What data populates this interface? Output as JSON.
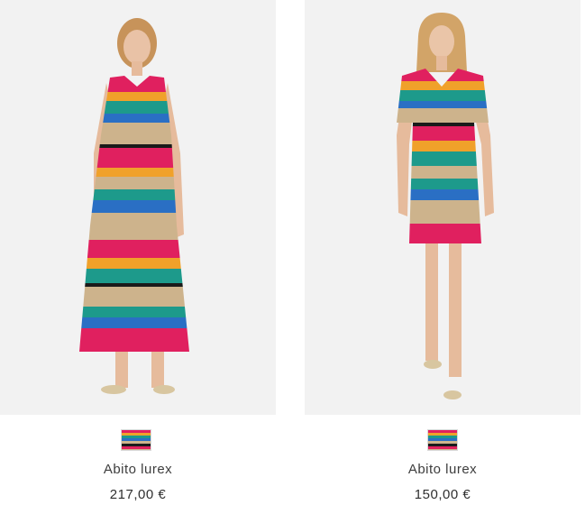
{
  "products": [
    {
      "name": "Abito lurex",
      "price": "217,00 €",
      "image_icon": "long-striped-dress-model-photo",
      "swatch_colors": [
        "#e0205f",
        "#f0a12a",
        "#1d9a8b",
        "#2a6fc4",
        "#cdb38c",
        "#1a1a1a",
        "#e0205f",
        "#cdb38c"
      ]
    },
    {
      "name": "Abito lurex",
      "price": "150,00 €",
      "image_icon": "short-striped-dress-model-photo",
      "swatch_colors": [
        "#e0205f",
        "#f0a12a",
        "#1d9a8b",
        "#2a6fc4",
        "#cdb38c",
        "#1a1a1a",
        "#e0205f",
        "#cdb38c"
      ]
    }
  ],
  "colors": {
    "photo_background": "#f2f2f2",
    "stripe_pink": "#e0205f",
    "stripe_orange": "#f0a12a",
    "stripe_teal": "#1d9a8b",
    "stripe_blue": "#2a6fc4",
    "stripe_beige": "#cdb38c"
  }
}
